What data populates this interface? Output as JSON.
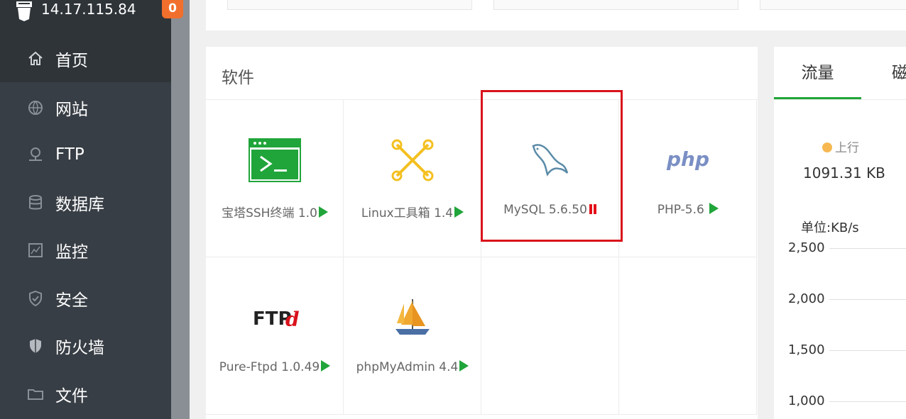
{
  "sidebar": {
    "ip": "14.17.115.84",
    "badge": "0",
    "items": [
      {
        "label": "首页",
        "icon": "home-icon"
      },
      {
        "label": "网站",
        "icon": "globe-icon"
      },
      {
        "label": "FTP",
        "icon": "ftp-icon"
      },
      {
        "label": "数据库",
        "icon": "database-icon"
      },
      {
        "label": "监控",
        "icon": "monitor-icon"
      },
      {
        "label": "安全",
        "icon": "shield-icon"
      },
      {
        "label": "防火墙",
        "icon": "firewall-icon"
      },
      {
        "label": "文件",
        "icon": "folder-icon"
      }
    ]
  },
  "software": {
    "title": "软件",
    "items": [
      {
        "label": "宝塔SSH终端 1.0",
        "icon": "terminal-icon",
        "status": "play"
      },
      {
        "label": "Linux工具箱 1.4",
        "icon": "tools-icon",
        "status": "play"
      },
      {
        "label": "MySQL 5.6.50",
        "icon": "mysql-icon",
        "status": "pause"
      },
      {
        "label": "PHP-5.6 ",
        "icon": "php-icon",
        "status": "play"
      },
      {
        "label": "Pure-Ftpd 1.0.49",
        "icon": "ftpd-icon",
        "status": "play"
      },
      {
        "label": "phpMyAdmin 4.4",
        "icon": "phpmyadmin-icon",
        "status": "play"
      }
    ]
  },
  "traffic": {
    "tabs": [
      "流量",
      "磁"
    ],
    "legend_up": "上行",
    "up_value": "1091.31 KB",
    "unit": "单位:KB/s",
    "yticks": [
      "2,500",
      "2,000",
      "1,500",
      "1,000"
    ]
  },
  "colors": {
    "accent": "#20a53a",
    "sidebar_bg": "#383e45",
    "badge": "#f16f2c",
    "highlight": "#d9131c",
    "pause": "#e4101a",
    "legend_up": "#f7b851"
  }
}
